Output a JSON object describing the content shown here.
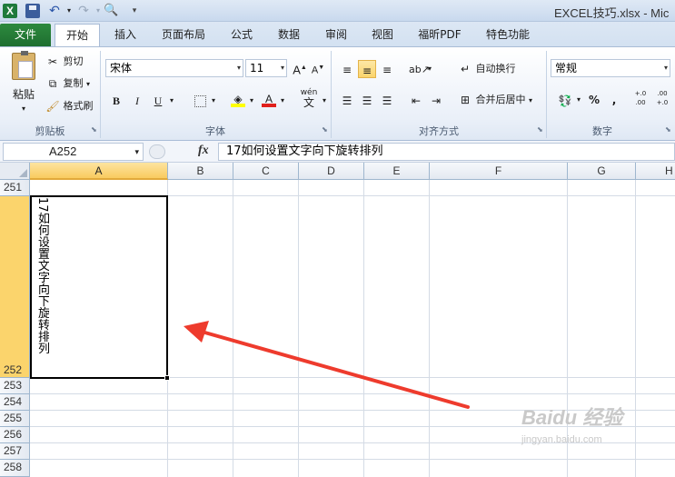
{
  "window": {
    "title": "EXCEL技巧.xlsx - Mic"
  },
  "qat": {
    "app_icon": "excel-icon",
    "icons": [
      "save-icon",
      "undo-icon",
      "redo-icon",
      "print-preview-icon",
      "customize-dropdown-icon"
    ]
  },
  "tabs": [
    {
      "label": "文件"
    },
    {
      "label": "开始"
    },
    {
      "label": "插入"
    },
    {
      "label": "页面布局"
    },
    {
      "label": "公式"
    },
    {
      "label": "数据"
    },
    {
      "label": "审阅"
    },
    {
      "label": "视图"
    },
    {
      "label": "福昕PDF"
    },
    {
      "label": "特色功能"
    }
  ],
  "ribbon": {
    "clipboard": {
      "group_label": "剪贴板",
      "paste_label": "粘贴",
      "cut_label": "剪切",
      "copy_label": "复制",
      "format_painter_label": "格式刷"
    },
    "font": {
      "group_label": "字体",
      "font_name": "宋体",
      "font_size": "11",
      "grow_label": "A",
      "shrink_label": "A",
      "bold_label": "B",
      "italic_label": "I",
      "underline_label": "U",
      "font_color_label": "A",
      "phonetic_label": "wén",
      "phonetic_sub": "文"
    },
    "alignment": {
      "group_label": "对齐方式",
      "wrap_text_label": "自动换行",
      "merge_label": "合并后居中"
    },
    "number": {
      "group_label": "数字",
      "format_value": "常规",
      "percent_label": "%",
      "comma_label": ",",
      "increase_decimal_label": "+.0 .00",
      "decrease_decimal_label": ".00 +.0"
    },
    "accent_color": "#fbd46c"
  },
  "formula_bar": {
    "name_box": "A252",
    "fx_label": "fx",
    "content": "17如何设置文字向下旋转排列"
  },
  "sheet": {
    "columns": [
      "A",
      "B",
      "C",
      "D",
      "E",
      "F",
      "G",
      "H"
    ],
    "selected_column": "A",
    "rows": [
      "251",
      "252",
      "253",
      "254",
      "255",
      "256",
      "257",
      "258"
    ],
    "selected_row": "252",
    "cell_a252": "17如何设置文字向下旋转排列"
  },
  "annotation": {
    "arrow_color": "#ee3b2d"
  },
  "watermark": {
    "logo": "Baidu 经验",
    "url": "jingyan.baidu.com"
  }
}
